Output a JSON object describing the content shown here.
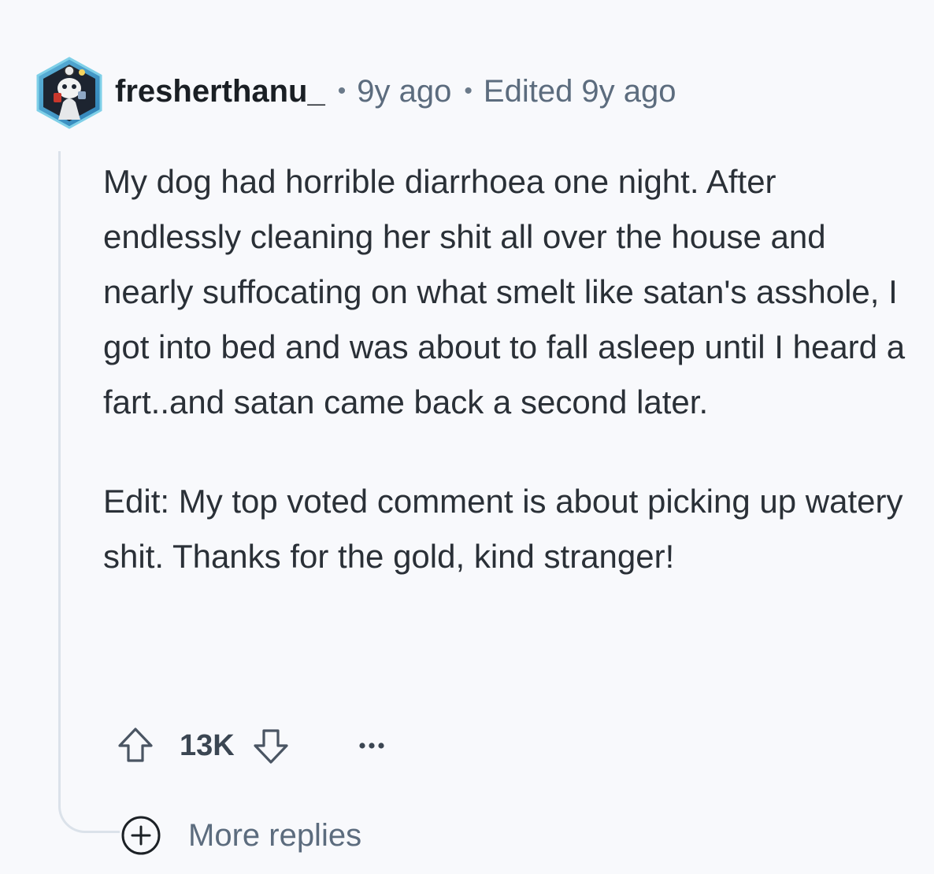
{
  "comment": {
    "author": "fresherthanu_",
    "separator": "•",
    "time": "9y ago",
    "edited": "Edited 9y ago",
    "paragraphs": [
      "My dog had horrible diarrhoea one night. After endlessly cleaning her shit all over the house and nearly suffocating on what smelt like satan's asshole, I got into bed and was about to fall asleep until I heard a fart..and satan came back a second later.",
      "Edit: My top voted comment is about picking up watery shit. Thanks for the gold, kind stranger!"
    ],
    "score": "13K"
  },
  "actions": {
    "upvote_icon": "arrow-up-outline-icon",
    "downvote_icon": "arrow-down-outline-icon",
    "overflow_icon": "ellipsis-icon"
  },
  "replies": {
    "icon": "plus-circle-icon",
    "label": "More replies"
  }
}
